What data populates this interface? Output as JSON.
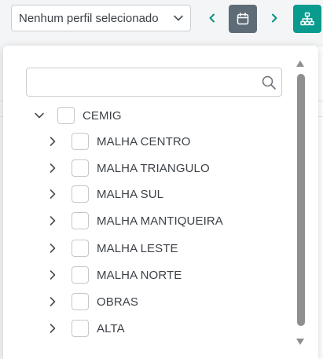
{
  "toolbar": {
    "profile_select_value": "Nenhum perfil selecionado",
    "icons": {
      "profile_chevron": "chevron-down-icon",
      "prev": "chevron-left-icon",
      "calendar": "calendar-icon",
      "next": "chevron-right-icon",
      "hierarchy": "hierarchy-icon"
    }
  },
  "dropdown": {
    "search": {
      "value": "",
      "placeholder": "",
      "icon": "search-icon"
    },
    "tree": {
      "root": {
        "label": "CEMIG",
        "expanded": true,
        "checked": false
      },
      "children": [
        {
          "label": "MALHA CENTRO",
          "expanded": false,
          "checked": false
        },
        {
          "label": "MALHA TRIANGULO",
          "expanded": false,
          "checked": false
        },
        {
          "label": "MALHA SUL",
          "expanded": false,
          "checked": false
        },
        {
          "label": "MALHA MANTIQUEIRA",
          "expanded": false,
          "checked": false
        },
        {
          "label": "MALHA LESTE",
          "expanded": false,
          "checked": false
        },
        {
          "label": "MALHA NORTE",
          "expanded": false,
          "checked": false
        },
        {
          "label": "OBRAS",
          "expanded": false,
          "checked": false
        },
        {
          "label": "ALTA",
          "expanded": false,
          "checked": false
        }
      ]
    }
  },
  "colors": {
    "accent_teal": "#0a9b8f",
    "calendar_button": "#5e6c78",
    "arrow_teal": "#0a8f85",
    "checkbox_border": "#c3c8ce",
    "text": "#3d4248",
    "scrollbar_thumb": "#8f8f8f"
  }
}
